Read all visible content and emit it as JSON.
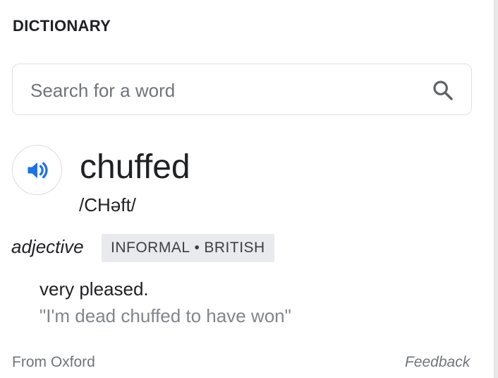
{
  "header": {
    "title": "DICTIONARY"
  },
  "search": {
    "placeholder": "Search for a word"
  },
  "entry": {
    "word": "chuffed",
    "phonetic": "/CHəft/",
    "part_of_speech": "adjective",
    "tags": [
      "INFORMAL",
      "BRITISH"
    ],
    "tag_separator": "•",
    "definition": "very pleased.",
    "example": "\"I'm dead chuffed to have won\""
  },
  "footer": {
    "source": "From Oxford",
    "feedback": "Feedback"
  },
  "icons": {
    "search": "search-icon",
    "audio": "speaker-icon"
  },
  "colors": {
    "accent": "#1a73e8",
    "text": "#202124",
    "muted": "#70757a",
    "tag_bg": "#e8eaed"
  }
}
